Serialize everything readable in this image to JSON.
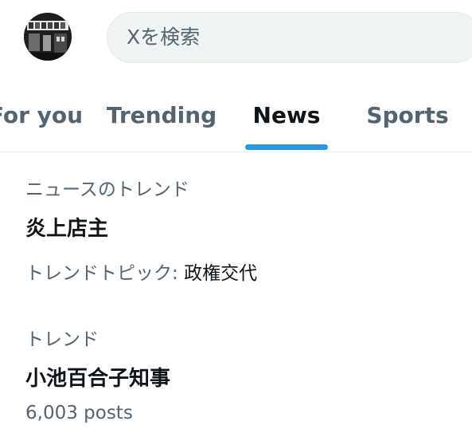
{
  "search": {
    "placeholder": "Xを検索"
  },
  "tabs": [
    {
      "label": "For you"
    },
    {
      "label": "Trending"
    },
    {
      "label": "News"
    },
    {
      "label": "Sports"
    }
  ],
  "active_tab": "News",
  "trends": [
    {
      "category": "ニュースのトレンド",
      "title": "炎上店主",
      "meta_prefix": "トレンドトピック: ",
      "meta_topic": "政権交代"
    },
    {
      "category": "トレンド",
      "title": "小池百合子知事",
      "meta": "6,003 posts"
    }
  ],
  "colors": {
    "accent": "#1d9bf0",
    "secondary_text": "#536471",
    "primary_text": "#0f1419"
  },
  "icons": {
    "avatar": "profile-photo"
  }
}
